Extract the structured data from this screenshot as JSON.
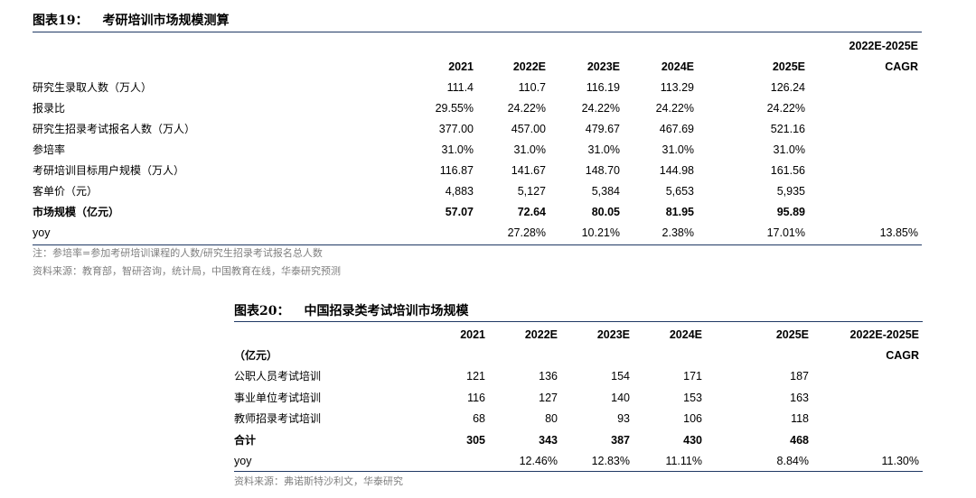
{
  "table19": {
    "title_label": "图表19：",
    "title_text": "考研培训市场规模测算",
    "cagr_top": "2022E-2025E",
    "cagr_bottom": "CAGR",
    "years": [
      "2021",
      "2022E",
      "2023E",
      "2024E",
      "2025E"
    ],
    "rows": [
      {
        "label": "研究生录取人数（万人）",
        "values": [
          "111.4",
          "110.7",
          "116.19",
          "113.29",
          "126.24",
          ""
        ]
      },
      {
        "label": "报录比",
        "values": [
          "29.55%",
          "24.22%",
          "24.22%",
          "24.22%",
          "24.22%",
          ""
        ]
      },
      {
        "label": "研究生招录考试报名人数（万人）",
        "values": [
          "377.00",
          "457.00",
          "479.67",
          "467.69",
          "521.16",
          ""
        ]
      },
      {
        "label": "参培率",
        "values": [
          "31.0%",
          "31.0%",
          "31.0%",
          "31.0%",
          "31.0%",
          ""
        ]
      },
      {
        "label": "考研培训目标用户规模（万人）",
        "values": [
          "116.87",
          "141.67",
          "148.70",
          "144.98",
          "161.56",
          ""
        ]
      },
      {
        "label": "客单价（元）",
        "values": [
          "4,883",
          "5,127",
          "5,384",
          "5,653",
          "5,935",
          ""
        ]
      },
      {
        "label": "市场规模（亿元）",
        "values": [
          "57.07",
          "72.64",
          "80.05",
          "81.95",
          "95.89",
          ""
        ],
        "bold": true
      },
      {
        "label": "yoy",
        "values": [
          "",
          "27.28%",
          "10.21%",
          "2.38%",
          "17.01%",
          "13.85%"
        ],
        "yoy": true
      }
    ],
    "note": "注：参培率=参加考研培训课程的人数/研究生招录考试报名总人数",
    "source": "资料来源：教育部，智研咨询，统计局，中国教育在线，华泰研究预测"
  },
  "table20": {
    "title_label": "图表20：",
    "title_text": "中国招录类考试培训市场规模",
    "unit_label": "（亿元）",
    "cagr_top": "2022E-2025E",
    "cagr_bottom": "CAGR",
    "years": [
      "2021",
      "2022E",
      "2023E",
      "2024E",
      "2025E"
    ],
    "rows": [
      {
        "label": "公职人员考试培训",
        "values": [
          "121",
          "136",
          "154",
          "171",
          "187",
          ""
        ]
      },
      {
        "label": "事业单位考试培训",
        "values": [
          "116",
          "127",
          "140",
          "153",
          "163",
          ""
        ]
      },
      {
        "label": "教师招录考试培训",
        "values": [
          "68",
          "80",
          "93",
          "106",
          "118",
          ""
        ]
      },
      {
        "label": "合计",
        "values": [
          "305",
          "343",
          "387",
          "430",
          "468",
          ""
        ],
        "bold": true
      },
      {
        "label": "yoy",
        "values": [
          "",
          "12.46%",
          "12.83%",
          "11.11%",
          "8.84%",
          "11.30%"
        ],
        "yoy": true
      }
    ],
    "source": "资料来源：弗诺斯特沙利文，华泰研究"
  }
}
